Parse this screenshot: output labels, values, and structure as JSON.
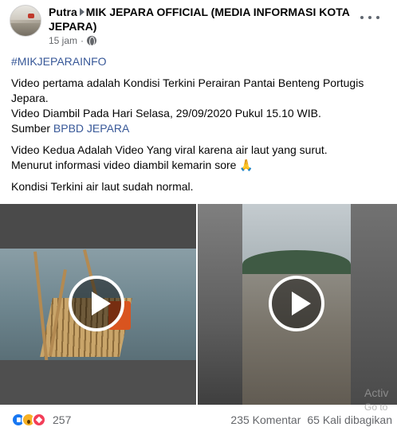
{
  "post": {
    "author": "Putra",
    "group": "MIK JEPARA OFFICIAL (MEDIA INFORMASI KOTA JEPARA)",
    "time": "15 jam",
    "hashtag": "#MIKJEPARAINFO",
    "paragraph1_line1": "Video pertama adalah Kondisi Terkini Perairan Pantai Benteng Portugis Jepara.",
    "paragraph1_line2": "Video Diambil Pada Hari Selasa, 29/09/2020 Pukul 15.10 WIB.",
    "source_prefix": "Sumber ",
    "source_link": "BPBD JEPARA",
    "paragraph2_line1": "Video Kedua Adalah Video Yang viral karena air laut yang surut.",
    "paragraph2_line2": "Menurut informasi video diambil kemarin sore ",
    "paragraph2_emoji": "🙏",
    "paragraph3": "Kondisi Terkini air laut sudah normal."
  },
  "footer": {
    "reaction_count": "257",
    "comments": "235 Komentar",
    "shares": "65 Kali dibagikan"
  },
  "watermark": {
    "line1": "Activ",
    "line2": "Go to"
  },
  "icons": {
    "reactions": [
      "like-icon",
      "wow-icon",
      "love-icon"
    ],
    "play": "play-icon",
    "more": "more-options-icon",
    "privacy": "globe-icon"
  }
}
